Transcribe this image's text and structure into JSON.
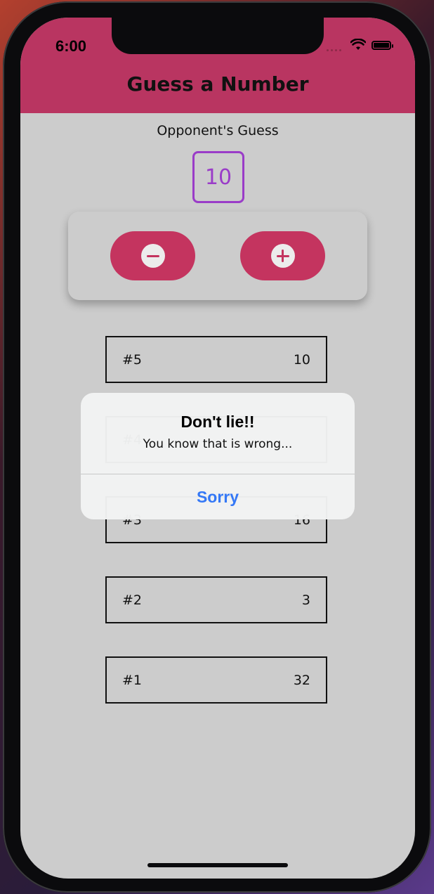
{
  "status_bar": {
    "time": "6:00",
    "icons": [
      "signal-dots-icon",
      "wifi-icon",
      "battery-icon"
    ]
  },
  "header": {
    "title": "Guess a Number",
    "background": "#b93561"
  },
  "game": {
    "opponent_label": "Opponent's Guess",
    "current_guess": "10",
    "controls": {
      "lower_icon": "minus-circle-icon",
      "higher_icon": "plus-circle-icon",
      "button_color": "#c4345f"
    }
  },
  "guesses": [
    {
      "round": "#5",
      "value": "10"
    },
    {
      "round": "#4",
      "value": ""
    },
    {
      "round": "#3",
      "value": "16"
    },
    {
      "round": "#2",
      "value": "3"
    },
    {
      "round": "#1",
      "value": "32"
    }
  ],
  "alert": {
    "title": "Don't lie!!",
    "message": "You know that is wrong...",
    "button_label": "Sorry",
    "button_color": "#3478f6"
  }
}
